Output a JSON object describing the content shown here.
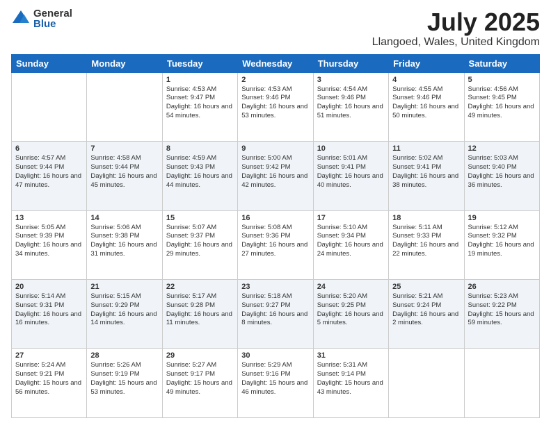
{
  "header": {
    "logo_general": "General",
    "logo_blue": "Blue",
    "month_title": "July 2025",
    "location": "Llangoed, Wales, United Kingdom"
  },
  "days_of_week": [
    "Sunday",
    "Monday",
    "Tuesday",
    "Wednesday",
    "Thursday",
    "Friday",
    "Saturday"
  ],
  "weeks": [
    [
      {
        "day": "",
        "content": ""
      },
      {
        "day": "",
        "content": ""
      },
      {
        "day": "1",
        "content": "Sunrise: 4:53 AM\nSunset: 9:47 PM\nDaylight: 16 hours and 54 minutes."
      },
      {
        "day": "2",
        "content": "Sunrise: 4:53 AM\nSunset: 9:46 PM\nDaylight: 16 hours and 53 minutes."
      },
      {
        "day": "3",
        "content": "Sunrise: 4:54 AM\nSunset: 9:46 PM\nDaylight: 16 hours and 51 minutes."
      },
      {
        "day": "4",
        "content": "Sunrise: 4:55 AM\nSunset: 9:46 PM\nDaylight: 16 hours and 50 minutes."
      },
      {
        "day": "5",
        "content": "Sunrise: 4:56 AM\nSunset: 9:45 PM\nDaylight: 16 hours and 49 minutes."
      }
    ],
    [
      {
        "day": "6",
        "content": "Sunrise: 4:57 AM\nSunset: 9:44 PM\nDaylight: 16 hours and 47 minutes."
      },
      {
        "day": "7",
        "content": "Sunrise: 4:58 AM\nSunset: 9:44 PM\nDaylight: 16 hours and 45 minutes."
      },
      {
        "day": "8",
        "content": "Sunrise: 4:59 AM\nSunset: 9:43 PM\nDaylight: 16 hours and 44 minutes."
      },
      {
        "day": "9",
        "content": "Sunrise: 5:00 AM\nSunset: 9:42 PM\nDaylight: 16 hours and 42 minutes."
      },
      {
        "day": "10",
        "content": "Sunrise: 5:01 AM\nSunset: 9:41 PM\nDaylight: 16 hours and 40 minutes."
      },
      {
        "day": "11",
        "content": "Sunrise: 5:02 AM\nSunset: 9:41 PM\nDaylight: 16 hours and 38 minutes."
      },
      {
        "day": "12",
        "content": "Sunrise: 5:03 AM\nSunset: 9:40 PM\nDaylight: 16 hours and 36 minutes."
      }
    ],
    [
      {
        "day": "13",
        "content": "Sunrise: 5:05 AM\nSunset: 9:39 PM\nDaylight: 16 hours and 34 minutes."
      },
      {
        "day": "14",
        "content": "Sunrise: 5:06 AM\nSunset: 9:38 PM\nDaylight: 16 hours and 31 minutes."
      },
      {
        "day": "15",
        "content": "Sunrise: 5:07 AM\nSunset: 9:37 PM\nDaylight: 16 hours and 29 minutes."
      },
      {
        "day": "16",
        "content": "Sunrise: 5:08 AM\nSunset: 9:36 PM\nDaylight: 16 hours and 27 minutes."
      },
      {
        "day": "17",
        "content": "Sunrise: 5:10 AM\nSunset: 9:34 PM\nDaylight: 16 hours and 24 minutes."
      },
      {
        "day": "18",
        "content": "Sunrise: 5:11 AM\nSunset: 9:33 PM\nDaylight: 16 hours and 22 minutes."
      },
      {
        "day": "19",
        "content": "Sunrise: 5:12 AM\nSunset: 9:32 PM\nDaylight: 16 hours and 19 minutes."
      }
    ],
    [
      {
        "day": "20",
        "content": "Sunrise: 5:14 AM\nSunset: 9:31 PM\nDaylight: 16 hours and 16 minutes."
      },
      {
        "day": "21",
        "content": "Sunrise: 5:15 AM\nSunset: 9:29 PM\nDaylight: 16 hours and 14 minutes."
      },
      {
        "day": "22",
        "content": "Sunrise: 5:17 AM\nSunset: 9:28 PM\nDaylight: 16 hours and 11 minutes."
      },
      {
        "day": "23",
        "content": "Sunrise: 5:18 AM\nSunset: 9:27 PM\nDaylight: 16 hours and 8 minutes."
      },
      {
        "day": "24",
        "content": "Sunrise: 5:20 AM\nSunset: 9:25 PM\nDaylight: 16 hours and 5 minutes."
      },
      {
        "day": "25",
        "content": "Sunrise: 5:21 AM\nSunset: 9:24 PM\nDaylight: 16 hours and 2 minutes."
      },
      {
        "day": "26",
        "content": "Sunrise: 5:23 AM\nSunset: 9:22 PM\nDaylight: 15 hours and 59 minutes."
      }
    ],
    [
      {
        "day": "27",
        "content": "Sunrise: 5:24 AM\nSunset: 9:21 PM\nDaylight: 15 hours and 56 minutes."
      },
      {
        "day": "28",
        "content": "Sunrise: 5:26 AM\nSunset: 9:19 PM\nDaylight: 15 hours and 53 minutes."
      },
      {
        "day": "29",
        "content": "Sunrise: 5:27 AM\nSunset: 9:17 PM\nDaylight: 15 hours and 49 minutes."
      },
      {
        "day": "30",
        "content": "Sunrise: 5:29 AM\nSunset: 9:16 PM\nDaylight: 15 hours and 46 minutes."
      },
      {
        "day": "31",
        "content": "Sunrise: 5:31 AM\nSunset: 9:14 PM\nDaylight: 15 hours and 43 minutes."
      },
      {
        "day": "",
        "content": ""
      },
      {
        "day": "",
        "content": ""
      }
    ]
  ]
}
